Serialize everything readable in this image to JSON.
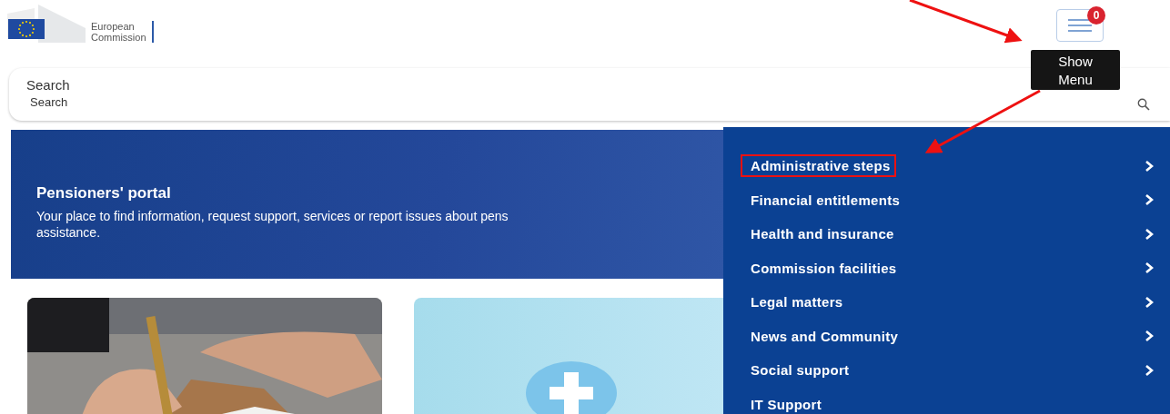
{
  "logo": {
    "lines": [
      "European",
      "Commission"
    ]
  },
  "menu_button": {
    "badge": "0",
    "tooltip": [
      "Show",
      "Menu"
    ]
  },
  "search": {
    "label": "Search",
    "placeholder": "Search"
  },
  "banner": {
    "title": "Pensioners' portal",
    "description_lines": [
      "Your place to find information, request support, services or report issues about pens",
      "assistance."
    ]
  },
  "cards": [
    {
      "kind": "picture"
    },
    {
      "kind": "illustration"
    }
  ],
  "menu": {
    "items": [
      {
        "label": "Administrative steps",
        "submenu": true,
        "highlighted": true
      },
      {
        "label": "Financial entitlements",
        "submenu": true,
        "highlighted": false
      },
      {
        "label": "Health and insurance",
        "submenu": true,
        "highlighted": false
      },
      {
        "label": "Commission facilities",
        "submenu": true,
        "highlighted": false
      },
      {
        "label": "Legal matters",
        "submenu": true,
        "highlighted": false
      },
      {
        "label": "News and Community",
        "submenu": true,
        "highlighted": false
      },
      {
        "label": "Social support",
        "submenu": true,
        "highlighted": false
      },
      {
        "label": "IT Support",
        "submenu": false,
        "highlighted": false
      }
    ]
  }
}
